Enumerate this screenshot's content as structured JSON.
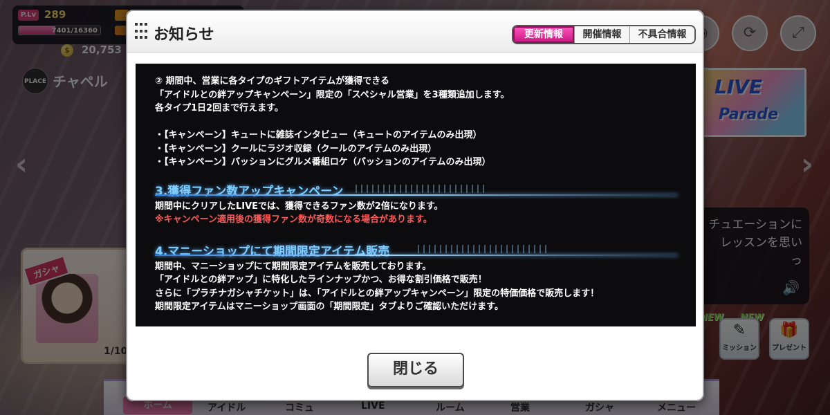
{
  "hud": {
    "plv_badge": "P.Lv",
    "plv_value": "289",
    "exp_text": "7401/16360",
    "exp_fraction": 0.452,
    "coin_value": "20,753",
    "place_badge": "PLACE",
    "place_name": "チャペル"
  },
  "banner": {
    "title": "LIVE",
    "subtitle": "Parade"
  },
  "dialogue": {
    "text": "チュエーションに\nレッスンを思い\nっ"
  },
  "gacha": {
    "ribbon": "ガシャ",
    "count": "1/10"
  },
  "side_buttons": {
    "new_label": "NEW",
    "mission_label": "ミッション",
    "present_label": "プレゼント"
  },
  "bottom_nav": [
    "ホーム",
    "アイドル",
    "コミュ",
    "LIVE",
    "ルーム",
    "営業",
    "ガシャ",
    "メニュー"
  ],
  "modal": {
    "title": "お知らせ",
    "tabs": [
      "更新情報",
      "開催情報",
      "不具合情報"
    ],
    "active_tab": 0,
    "close_label": "閉じる",
    "intro_lines": [
      "② 期間中、営業に各タイプのギフトアイテムが獲得できる",
      "「アイドルとの絆アップキャンペーン」限定の「スペシャル営業」を3種類追加します。",
      "各タイプ1日2回まで行えます。"
    ],
    "bullets": [
      "・【キャンペーン】キュートに雑誌インタビュー（キュートのアイテムのみ出現）",
      "・【キャンペーン】クールにラジオ収録（クールのアイテムのみ出現）",
      "・【キャンペーン】パッションにグルメ番組ロケ（パッションのアイテムのみ出現）"
    ],
    "section3": {
      "heading": "3.獲得ファン数アップキャンペーン",
      "body": "期間中にクリアしたLIVEでは、獲得できるファン数が2倍になります。",
      "note": "※キャンペーン適用後の獲得ファン数が奇数になる場合があります。"
    },
    "section4": {
      "heading": "4.マニーショップにて期間限定アイテム販売",
      "lines": [
        "期間中、マニーショップにて期間限定アイテムを販売しております。",
        "「アイドルとの絆アップ」に特化したラインナップかつ、お得な割引価格で販売！",
        "さらに「プラチナガシャチケット」は、「アイドルとの絆アップキャンペーン」限定の特価価格で販売します！",
        "期間限定アイテムはマニーショップ画面の「期間限定」タブよりご確認いただけます。"
      ]
    }
  },
  "colors": {
    "active_tab": "#e0359e",
    "section_heading": "#7fd0ff",
    "note_red": "#ff5a5a",
    "content_bg": "#0c0c0e"
  }
}
